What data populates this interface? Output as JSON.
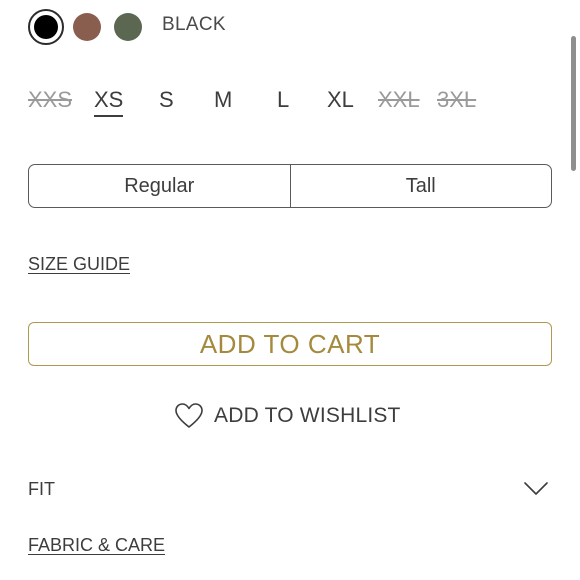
{
  "colors": {
    "selected_name": "BLACK",
    "swatches": [
      {
        "name": "black",
        "hex": "#000000",
        "selected": true
      },
      {
        "name": "brown",
        "hex": "#8a5e4e",
        "selected": false
      },
      {
        "name": "olive",
        "hex": "#5b6750",
        "selected": false
      }
    ]
  },
  "sizes": [
    {
      "label": "XXS",
      "available": false,
      "selected": false
    },
    {
      "label": "XS",
      "available": true,
      "selected": true
    },
    {
      "label": "S",
      "available": true,
      "selected": false
    },
    {
      "label": "M",
      "available": true,
      "selected": false
    },
    {
      "label": "L",
      "available": true,
      "selected": false
    },
    {
      "label": "XL",
      "available": true,
      "selected": false
    },
    {
      "label": "XXL",
      "available": false,
      "selected": false
    },
    {
      "label": "3XL",
      "available": false,
      "selected": false
    }
  ],
  "fit_toggle": {
    "options": [
      "Regular",
      "Tall"
    ]
  },
  "links": {
    "size_guide": "SIZE GUIDE",
    "fabric_care": "FABRIC & CARE"
  },
  "actions": {
    "add_to_cart": "ADD TO CART",
    "add_to_wishlist": "ADD TO WISHLIST",
    "accent_color": "#a38a3d"
  },
  "accordions": {
    "fit": {
      "title": "FIT",
      "icon": "chevron-down-icon"
    }
  }
}
